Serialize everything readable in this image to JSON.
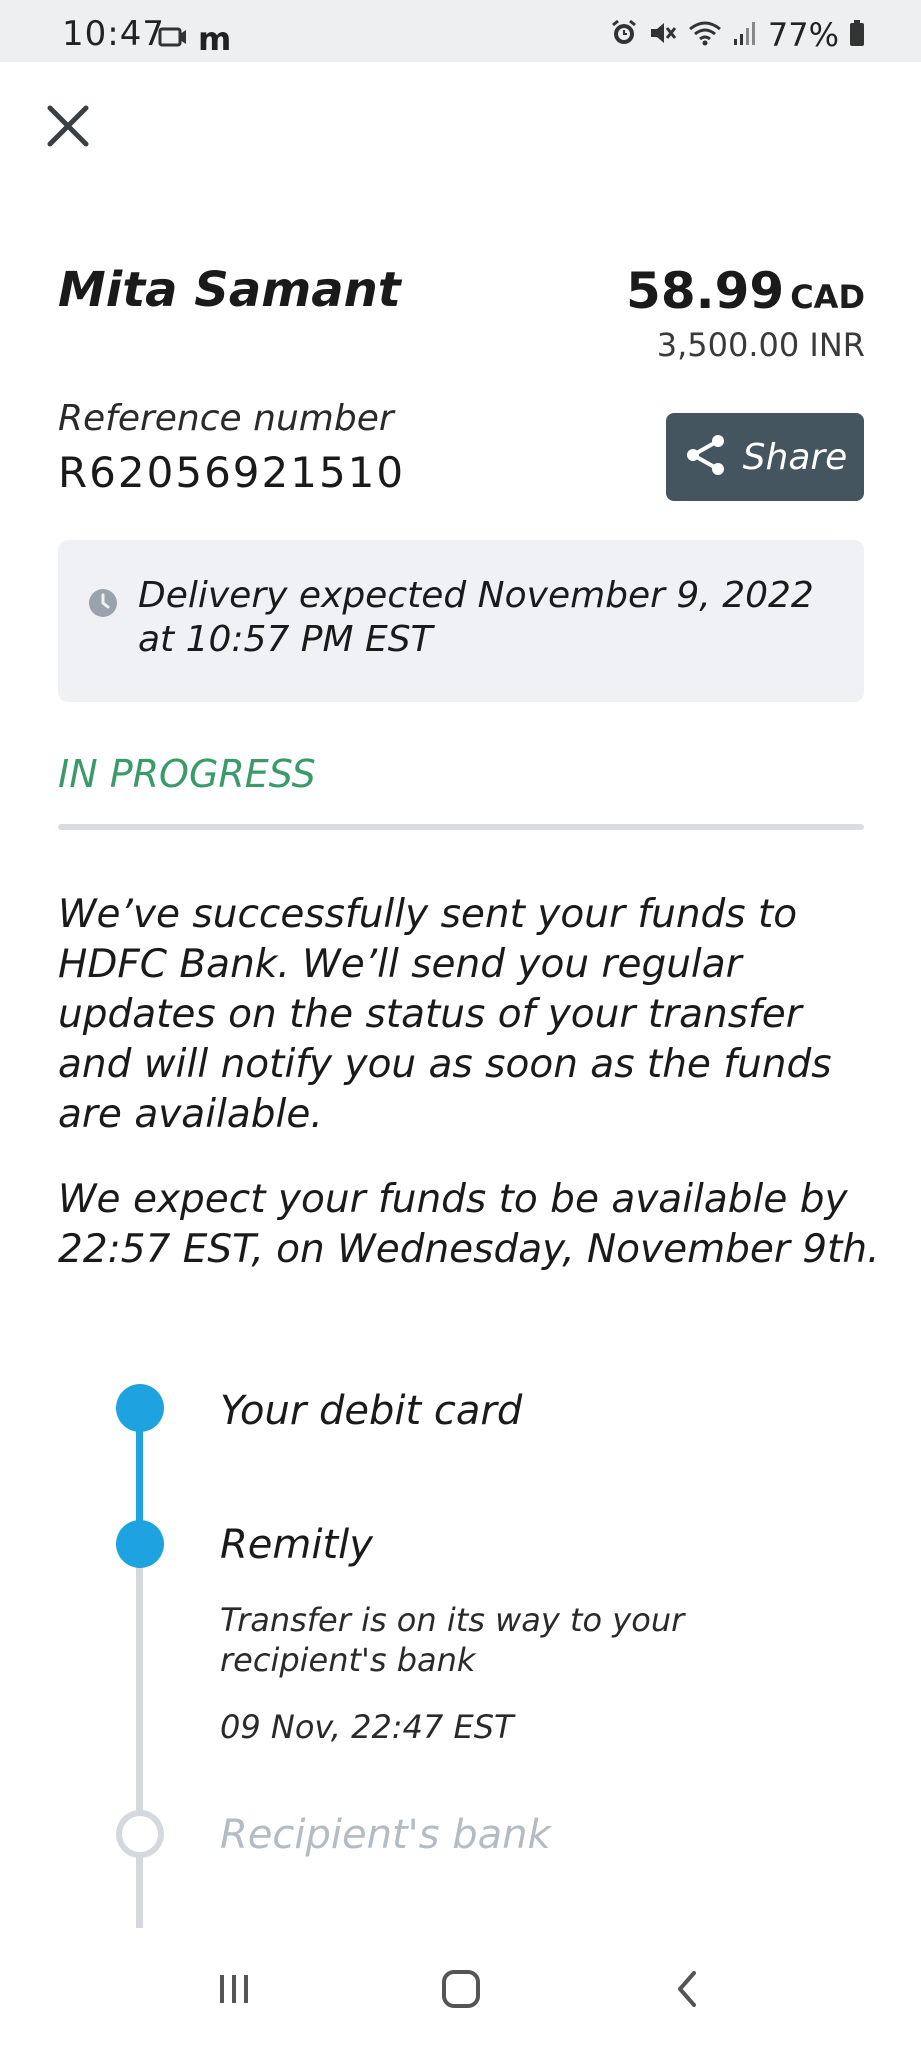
{
  "status_bar": {
    "time": "10:47",
    "carrier_icon": "m",
    "battery": "77%"
  },
  "transfer": {
    "recipient_name": "Mita Samant",
    "amount": "58.99",
    "currency": "CAD",
    "converted_amount": "3,500.00 INR",
    "reference_label": "Reference number",
    "reference_number": "R62056921510",
    "share_label": "Share"
  },
  "delivery": {
    "text": "Delivery expected November 9, 2022 at 10:57 PM EST"
  },
  "status": {
    "label": "IN PROGRESS",
    "color": "#3a9a6a"
  },
  "info": {
    "paragraph1": "We’ve successfully sent your funds to HDFC Bank. We’ll send you regular updates on the status of your transfer and will notify you as soon as the funds are available.",
    "paragraph2": "We expect your funds to be available by 22:57 EST, on Wednesday, November 9th."
  },
  "timeline": {
    "steps": [
      {
        "title": "Your debit card"
      },
      {
        "title": "Remitly",
        "description": "Transfer is on its way to your recipient's bank",
        "timestamp": "09 Nov, 22:47 EST"
      },
      {
        "title": "Recipient's bank"
      }
    ],
    "active_color": "#1ea3e0",
    "inactive_color": "#d5d9de"
  },
  "icons": {
    "close": "close-icon",
    "share": "share-icon",
    "clock": "clock-icon",
    "recents": "recents-icon",
    "home": "home-icon",
    "back": "back-icon"
  }
}
